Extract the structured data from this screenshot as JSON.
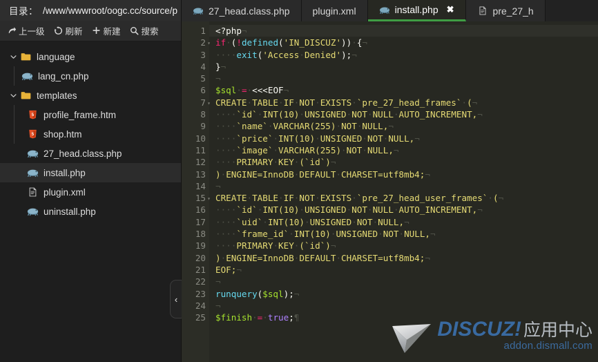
{
  "sidebar": {
    "path_bar": {
      "label": "目录：",
      "value": "/www/wwwroot/oogc.cc/source/p"
    },
    "toolbar": [
      {
        "icon": "arrow-up-level-icon",
        "label": "上一级"
      },
      {
        "icon": "refresh-icon",
        "label": "刷新"
      },
      {
        "icon": "plus-icon",
        "label": "新建"
      },
      {
        "icon": "search-icon",
        "label": "搜索"
      }
    ],
    "tree": [
      {
        "name": "language",
        "type": "folder",
        "depth": 0,
        "expanded": true,
        "selected": false
      },
      {
        "name": "lang_cn.php",
        "type": "php",
        "depth": 1,
        "expanded": null,
        "selected": false
      },
      {
        "name": "templates",
        "type": "folder",
        "depth": 0,
        "expanded": true,
        "selected": false
      },
      {
        "name": "profile_frame.htm",
        "type": "html",
        "depth": 1,
        "expanded": null,
        "selected": false
      },
      {
        "name": "shop.htm",
        "type": "html",
        "depth": 1,
        "expanded": null,
        "selected": false
      },
      {
        "name": "27_head.class.php",
        "type": "php",
        "depth": 0,
        "expanded": null,
        "selected": false
      },
      {
        "name": "install.php",
        "type": "php",
        "depth": 0,
        "expanded": null,
        "selected": true
      },
      {
        "name": "plugin.xml",
        "type": "xml",
        "depth": 0,
        "expanded": null,
        "selected": false
      },
      {
        "name": "uninstall.php",
        "type": "php",
        "depth": 0,
        "expanded": null,
        "selected": false
      }
    ],
    "collapse_handle": "‹"
  },
  "editor": {
    "tabs": [
      {
        "label": "27_head.class.php",
        "icon": "php-icon",
        "active": false,
        "closable": false
      },
      {
        "label": "plugin.xml",
        "icon": "none",
        "active": false,
        "closable": false
      },
      {
        "label": "install.php",
        "icon": "php-icon",
        "active": true,
        "closable": true,
        "close_glyph": "✖"
      },
      {
        "label": "pre_27_h",
        "icon": "xml-icon",
        "active": false,
        "closable": false
      }
    ],
    "language": "php",
    "current_line": 1,
    "fold_lines": [
      2,
      7,
      15
    ],
    "lines": [
      {
        "n": 1,
        "text": "<?php"
      },
      {
        "n": 2,
        "text": "if (!defined('IN_DISCUZ')) {"
      },
      {
        "n": 3,
        "text": "    exit('Access Denied');"
      },
      {
        "n": 4,
        "text": "}"
      },
      {
        "n": 5,
        "text": ""
      },
      {
        "n": 6,
        "text": "$sql = <<<EOF"
      },
      {
        "n": 7,
        "text": "CREATE TABLE IF NOT EXISTS `pre_27_head_frames` ("
      },
      {
        "n": 8,
        "text": "    `id` INT(10) UNSIGNED NOT NULL AUTO_INCREMENT,"
      },
      {
        "n": 9,
        "text": "    `name` VARCHAR(255) NOT NULL,"
      },
      {
        "n": 10,
        "text": "    `price` INT(10) UNSIGNED NOT NULL,"
      },
      {
        "n": 11,
        "text": "    `image` VARCHAR(255) NOT NULL,"
      },
      {
        "n": 12,
        "text": "    PRIMARY KEY (`id`)"
      },
      {
        "n": 13,
        "text": ") ENGINE=InnoDB DEFAULT CHARSET=utf8mb4;"
      },
      {
        "n": 14,
        "text": ""
      },
      {
        "n": 15,
        "text": "CREATE TABLE IF NOT EXISTS `pre_27_head_user_frames` ("
      },
      {
        "n": 16,
        "text": "    `id` INT(10) UNSIGNED NOT NULL AUTO_INCREMENT,"
      },
      {
        "n": 17,
        "text": "    `uid` INT(10) UNSIGNED NOT NULL,"
      },
      {
        "n": 18,
        "text": "    `frame_id` INT(10) UNSIGNED NOT NULL,"
      },
      {
        "n": 19,
        "text": "    PRIMARY KEY (`id`)"
      },
      {
        "n": 20,
        "text": ") ENGINE=InnoDB DEFAULT CHARSET=utf8mb4;"
      },
      {
        "n": 21,
        "text": "EOF;"
      },
      {
        "n": 22,
        "text": ""
      },
      {
        "n": 23,
        "text": "runquery($sql);"
      },
      {
        "n": 24,
        "text": ""
      },
      {
        "n": 25,
        "text": "$finish = true;"
      }
    ]
  },
  "watermark": {
    "brand": "DISCUZ",
    "bang": "!",
    "cn": "应用中心",
    "url": "addon.dismall.com"
  },
  "colors": {
    "accent_green": "#3f9d44",
    "editor_bg": "#272822",
    "sidebar_bg": "#1e1e1e",
    "folder_yellow": "#e8b339",
    "php_blue": "#6d9cb5",
    "html_orange": "#e34f26",
    "brand_blue": "#3a6ea8"
  }
}
